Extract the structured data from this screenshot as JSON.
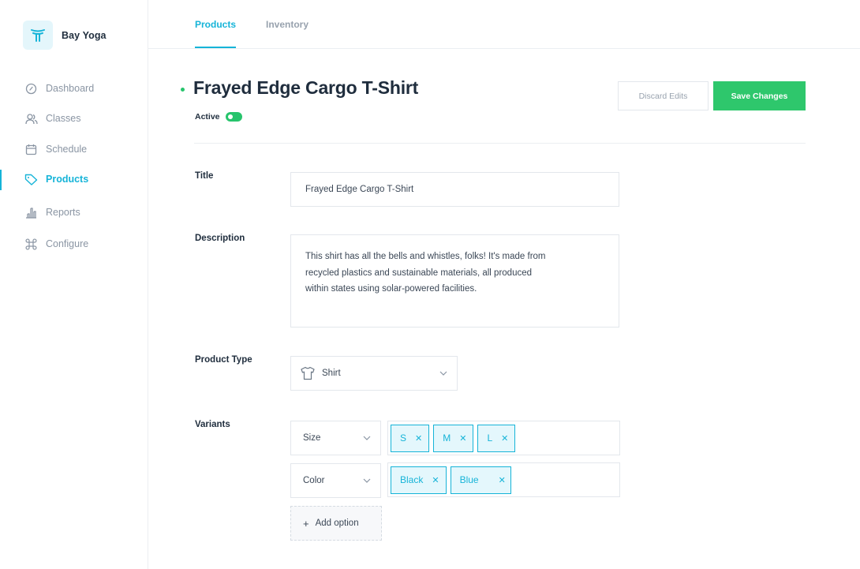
{
  "brand": {
    "name": "Bay Yoga",
    "logo_icon": "yoga-logo-icon"
  },
  "sidebar": {
    "items": [
      {
        "label": "Dashboard",
        "icon": "gauge-icon",
        "active": false
      },
      {
        "label": "Classes",
        "icon": "users-icon",
        "active": false
      },
      {
        "label": "Schedule",
        "icon": "calendar-icon",
        "active": false
      },
      {
        "label": "Products",
        "icon": "tag-icon",
        "active": true
      },
      {
        "label": "Reports",
        "icon": "bar-chart-icon",
        "active": false
      },
      {
        "label": "Configure",
        "icon": "command-icon",
        "active": false
      }
    ]
  },
  "tabs": [
    {
      "label": "Products",
      "active": true
    },
    {
      "label": "Inventory",
      "active": false
    }
  ],
  "product": {
    "title": "Frayed Edge Cargo T-Shirt",
    "status_label": "Active",
    "active": true
  },
  "actions": {
    "discard_label": "Discard Edits",
    "save_label": "Save Changes"
  },
  "form": {
    "title_label": "Title",
    "title_value": "Frayed Edge Cargo T-Shirt",
    "description_label": "Description",
    "description_lines": [
      "This shirt has all the bells and whistles, folks! It's made from",
      "recycled plastics and sustainable materials, all produced",
      "within states using solar-powered facilities."
    ],
    "product_type_label": "Product Type",
    "product_type_value": "Shirt",
    "product_type_icon": "shirt-icon",
    "variants_label": "Variants",
    "variants": [
      {
        "option": "Size",
        "values": [
          "S",
          "M",
          "L"
        ]
      },
      {
        "option": "Color",
        "values": [
          "Black",
          "Blue"
        ]
      }
    ],
    "add_option_label": "Add option"
  },
  "colors": {
    "accent": "#16b4d8",
    "success": "#2ec76c",
    "text": "#1f2d3d",
    "muted": "#8a95a3"
  }
}
